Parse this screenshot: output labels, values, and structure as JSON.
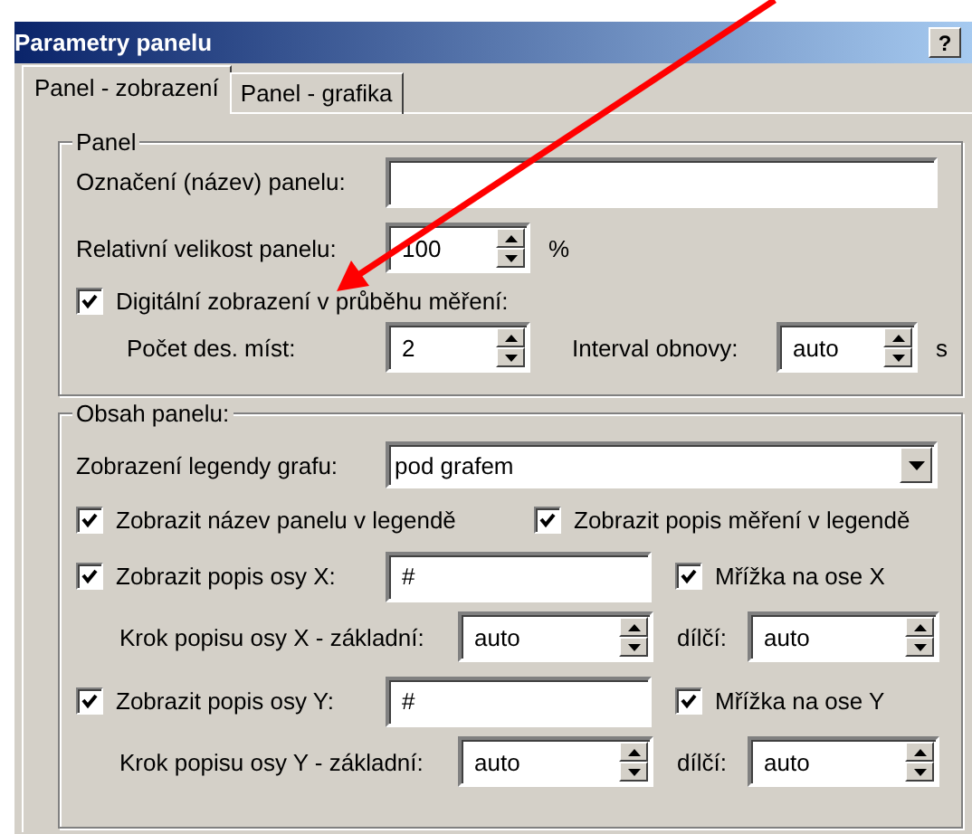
{
  "window": {
    "title": "Parametry panelu",
    "help_button": "?"
  },
  "tabs": [
    {
      "label": "Panel - zobrazení",
      "selected": true
    },
    {
      "label": "Panel - grafika",
      "selected": false
    }
  ],
  "panel_group": {
    "title": "Panel",
    "name": {
      "label": "Označení (název) panelu:"
    },
    "size": {
      "label": "Relativní velikost panelu:",
      "value": "100",
      "unit": "%"
    },
    "digital": {
      "label": "Digitální zobrazení v průběhu měření:",
      "checked": true
    },
    "decimals": {
      "label": "Počet des. míst:",
      "value": "2"
    },
    "refresh": {
      "label": "Interval obnovy:",
      "value": "auto",
      "unit": "s"
    }
  },
  "content_group": {
    "title": "Obsah panelu:",
    "legend": {
      "label": "Zobrazení legendy grafu:",
      "value": "pod grafem"
    },
    "legend_checks": [
      {
        "label": "Zobrazit název panelu v legendě",
        "checked": true
      },
      {
        "label": "Zobrazit popis měření v legendě",
        "checked": true
      }
    ],
    "axes": [
      {
        "label": "Zobrazit popis osy X:",
        "checked": true,
        "value": "#",
        "grid": {
          "label": "Mřížka na ose X",
          "checked": true
        },
        "step_label": "Krok popisu osy X - základní:",
        "step_value": "auto",
        "minor_label": "dílčí:",
        "minor_value": "auto"
      },
      {
        "label": "Zobrazit popis osy Y:",
        "checked": true,
        "value": "#",
        "grid": {
          "label": "Mřížka na ose Y",
          "checked": true
        },
        "step_label": "Krok popisu osy Y - základní:",
        "step_value": "auto",
        "minor_label": "dílčí:",
        "minor_value": "auto"
      }
    ]
  }
}
